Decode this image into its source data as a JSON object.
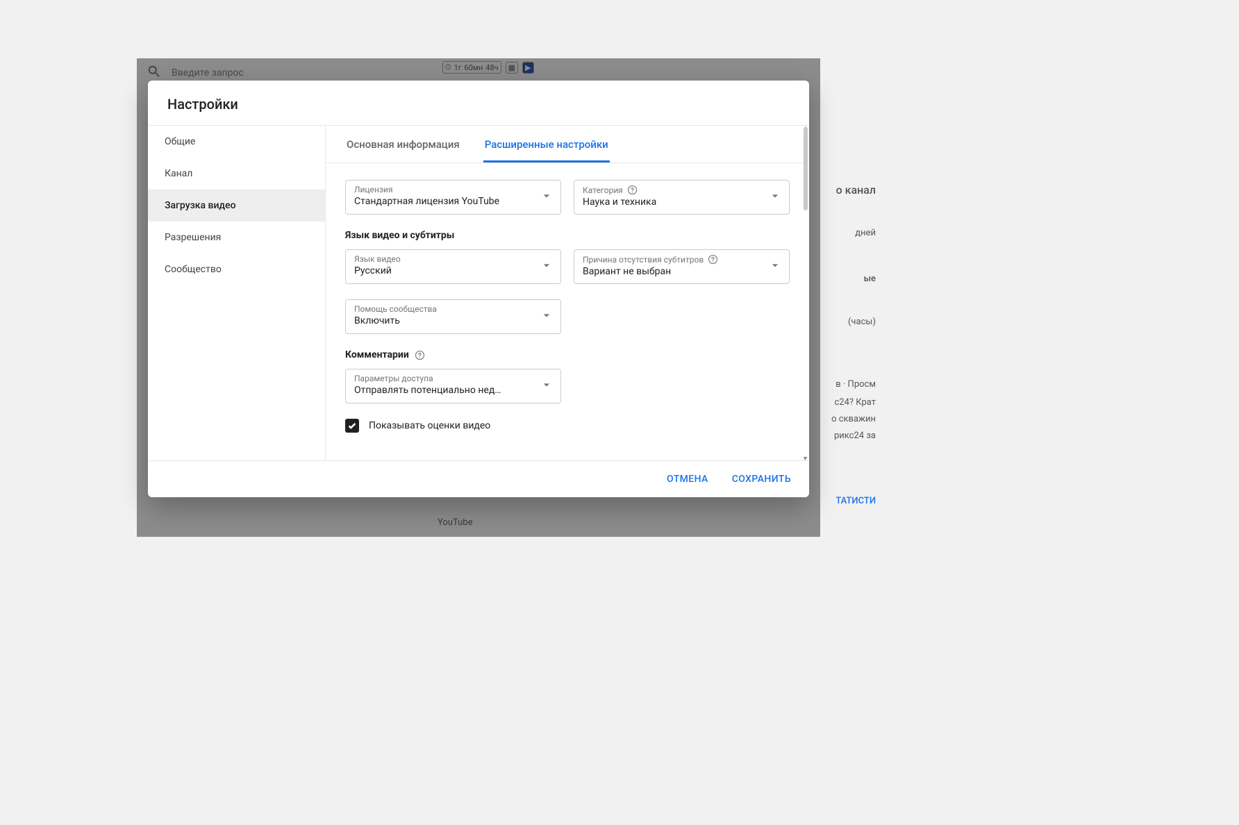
{
  "background": {
    "search_placeholder": "Введите запрос",
    "stats": [
      "1г",
      "60мн",
      "48ч"
    ],
    "right_lines": {
      "channel": "о канал",
      "days": "дней",
      "b": "ые",
      "hours": "(часы)",
      "views": "в · Просм",
      "item1": "с24? Крат",
      "item2": "о скважин",
      "item3": "рикс24 за",
      "stat": "ТАТИСТИ"
    },
    "youtube": "YouTube"
  },
  "dialog": {
    "title": "Настройки",
    "sidebar": [
      {
        "label": "Общие"
      },
      {
        "label": "Канал"
      },
      {
        "label": "Загрузка видео"
      },
      {
        "label": "Разрешения"
      },
      {
        "label": "Сообщество"
      }
    ],
    "active_sidebar_index": 2,
    "tabs": [
      {
        "label": "Основная информация"
      },
      {
        "label": "Расширенные настройки"
      }
    ],
    "active_tab_index": 1,
    "fields": {
      "license": {
        "label": "Лицензия",
        "value": "Стандартная лицензия YouTube"
      },
      "category": {
        "label": "Категория",
        "value": "Наука и техника"
      },
      "lang_section": "Язык видео и субтитры",
      "video_lang": {
        "label": "Язык видео",
        "value": "Русский"
      },
      "caption_absent": {
        "label": "Причина отсутствия субтитров",
        "value": "Вариант не выбран"
      },
      "community_help": {
        "label": "Помощь сообщества",
        "value": "Включить"
      },
      "comments_section": "Комментарии",
      "comment_access": {
        "label": "Параметры доступа",
        "value": "Отправлять потенциально нед…"
      },
      "show_ratings": "Показывать оценки видео"
    },
    "footer": {
      "cancel": "ОТМЕНА",
      "save": "СОХРАНИТЬ"
    }
  }
}
